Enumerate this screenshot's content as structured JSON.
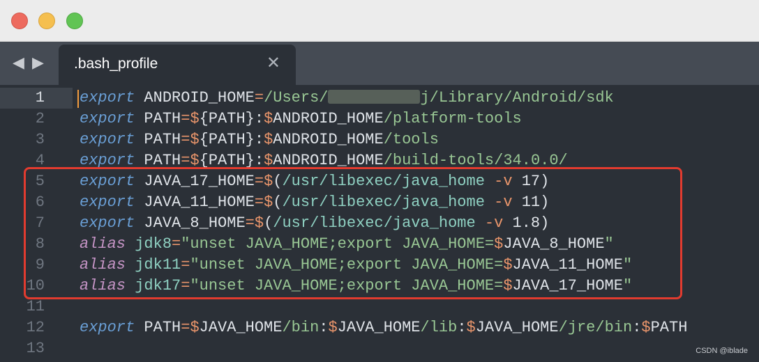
{
  "window": {
    "nav_back": "◀",
    "nav_forward": "▶",
    "close_glyph": "✕"
  },
  "tab": {
    "label": ".bash_profile"
  },
  "lines": [
    {
      "num": "1",
      "tokens": {
        "kw": "export",
        "name": "ANDROID_HOME",
        "eq": "=",
        "p1": "/Users/",
        "p2": "j/Library/Android/sdk"
      }
    },
    {
      "num": "2",
      "tokens": {
        "kw": "export",
        "name": "PATH",
        "eq": "=",
        "d1": "$",
        "v1": "{PATH}",
        "c": ":",
        "d2": "$",
        "v2": "ANDROID_HOME",
        "p": "/platform-tools"
      }
    },
    {
      "num": "3",
      "tokens": {
        "kw": "export",
        "name": "PATH",
        "eq": "=",
        "d1": "$",
        "v1": "{PATH}",
        "c": ":",
        "d2": "$",
        "v2": "ANDROID_HOME",
        "p": "/tools"
      }
    },
    {
      "num": "4",
      "tokens": {
        "kw": "export",
        "name": "PATH",
        "eq": "=",
        "d1": "$",
        "v1": "{PATH}",
        "c": ":",
        "d2": "$",
        "v2": "ANDROID_HOME",
        "p": "/build-tools/34.0.0/"
      }
    },
    {
      "num": "5",
      "tokens": {
        "kw": "export",
        "name": "JAVA_17_HOME",
        "eq": "=",
        "d": "$",
        "lp": "(",
        "p": "/usr/libexec/java_home",
        "f": "-v",
        "v": " 17)"
      }
    },
    {
      "num": "6",
      "tokens": {
        "kw": "export",
        "name": "JAVA_11_HOME",
        "eq": "=",
        "d": "$",
        "lp": "(",
        "p": "/usr/libexec/java_home",
        "f": "-v",
        "v": " 11)"
      }
    },
    {
      "num": "7",
      "tokens": {
        "kw": "export",
        "name": "JAVA_8_HOME",
        "eq": "=",
        "d": "$",
        "lp": "(",
        "p": "/usr/libexec/java_home",
        "f": "-v",
        "v": " 1.8)"
      }
    },
    {
      "num": "8",
      "tokens": {
        "kw": "alias",
        "name": "jdk8",
        "eq": "=",
        "s1": "\"unset JAVA_HOME;export JAVA_HOME=",
        "d": "$",
        "v": "JAVA_8_HOME",
        "s2": "\""
      }
    },
    {
      "num": "9",
      "tokens": {
        "kw": "alias",
        "name": "jdk11",
        "eq": "=",
        "s1": "\"unset JAVA_HOME;export JAVA_HOME=",
        "d": "$",
        "v": "JAVA_11_HOME",
        "s2": "\""
      }
    },
    {
      "num": "10",
      "tokens": {
        "kw": "alias",
        "name": "jdk17",
        "eq": "=",
        "s1": "\"unset JAVA_HOME;export JAVA_HOME=",
        "d": "$",
        "v": "JAVA_17_HOME",
        "s2": "\""
      }
    },
    {
      "num": "11",
      "tokens": {}
    },
    {
      "num": "12",
      "tokens": {
        "kw": "export",
        "name": "PATH",
        "eq": "=",
        "d1": "$",
        "v1": "JAVA_HOME",
        "p1": "/bin",
        "c1": ":",
        "d2": "$",
        "v2": "JAVA_HOME",
        "p2": "/lib",
        "c2": ":",
        "d3": "$",
        "v3": "JAVA_HOME",
        "p3": "/jre/bin",
        "c3": ":",
        "d4": "$",
        "v4": "PATH"
      }
    },
    {
      "num": "13",
      "tokens": {}
    }
  ],
  "watermark": "CSDN @iblade",
  "colors": {
    "highlight_box": "#e23b2f",
    "cursor": "#f39c3f"
  }
}
